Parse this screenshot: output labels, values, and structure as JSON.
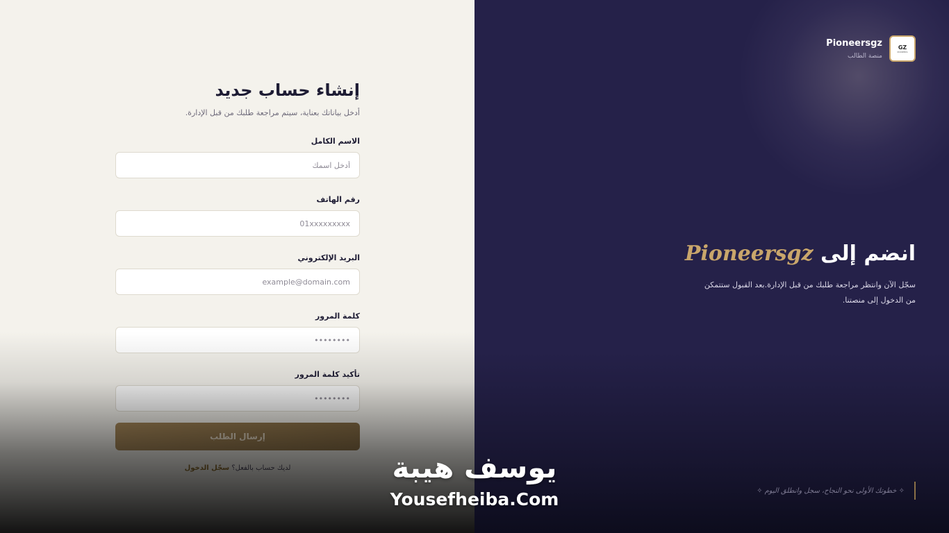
{
  "brand": {
    "logo_text": "GZ",
    "logo_sub": "PIONEERS",
    "name": "Pioneersgz",
    "tagline": "منصة الطالب"
  },
  "hero": {
    "title_prefix": "انضم إلى",
    "title_accent": "Pioneersgz",
    "description": "سجّل الآن وانتظر مراجعة طلبك من قبل الإدارة.بعد القبول ستتمكن من الدخول إلى منصتنا.",
    "quote": "✧ خطوتك الأولى نحو النجاح، سجل وانطلق اليوم ✧"
  },
  "form": {
    "title": "إنشاء حساب جديد",
    "subtitle": "أدخل بياناتك بعناية، سيتم مراجعة طلبك من قبل الإدارة.",
    "fields": [
      {
        "label": "الاسم الكامل",
        "placeholder": "أدخل اسمك",
        "value": ""
      },
      {
        "label": "رقم الهاتف",
        "placeholder": "01xxxxxxxxx",
        "value": ""
      },
      {
        "label": "البريد الإلكتروني",
        "placeholder": "example@domain.com",
        "value": ""
      },
      {
        "label": "كلمة المرور",
        "placeholder": "••••••••",
        "value": ""
      },
      {
        "label": "تأكيد كلمة المرور",
        "placeholder": "••••••••",
        "value": ""
      }
    ],
    "submit_label": "إرسال الطلب",
    "have_account": "لديك حساب بالفعل؟",
    "login_link": "سجّل الدخول"
  },
  "watermark": {
    "arabic": "يوسف هيبة",
    "url": "Yousefheiba.Com"
  },
  "colors": {
    "accent_gold": "#c9a66b",
    "panel_dark": "#252149",
    "panel_light": "#f4f2ec",
    "button_gold": "#a8895a"
  }
}
